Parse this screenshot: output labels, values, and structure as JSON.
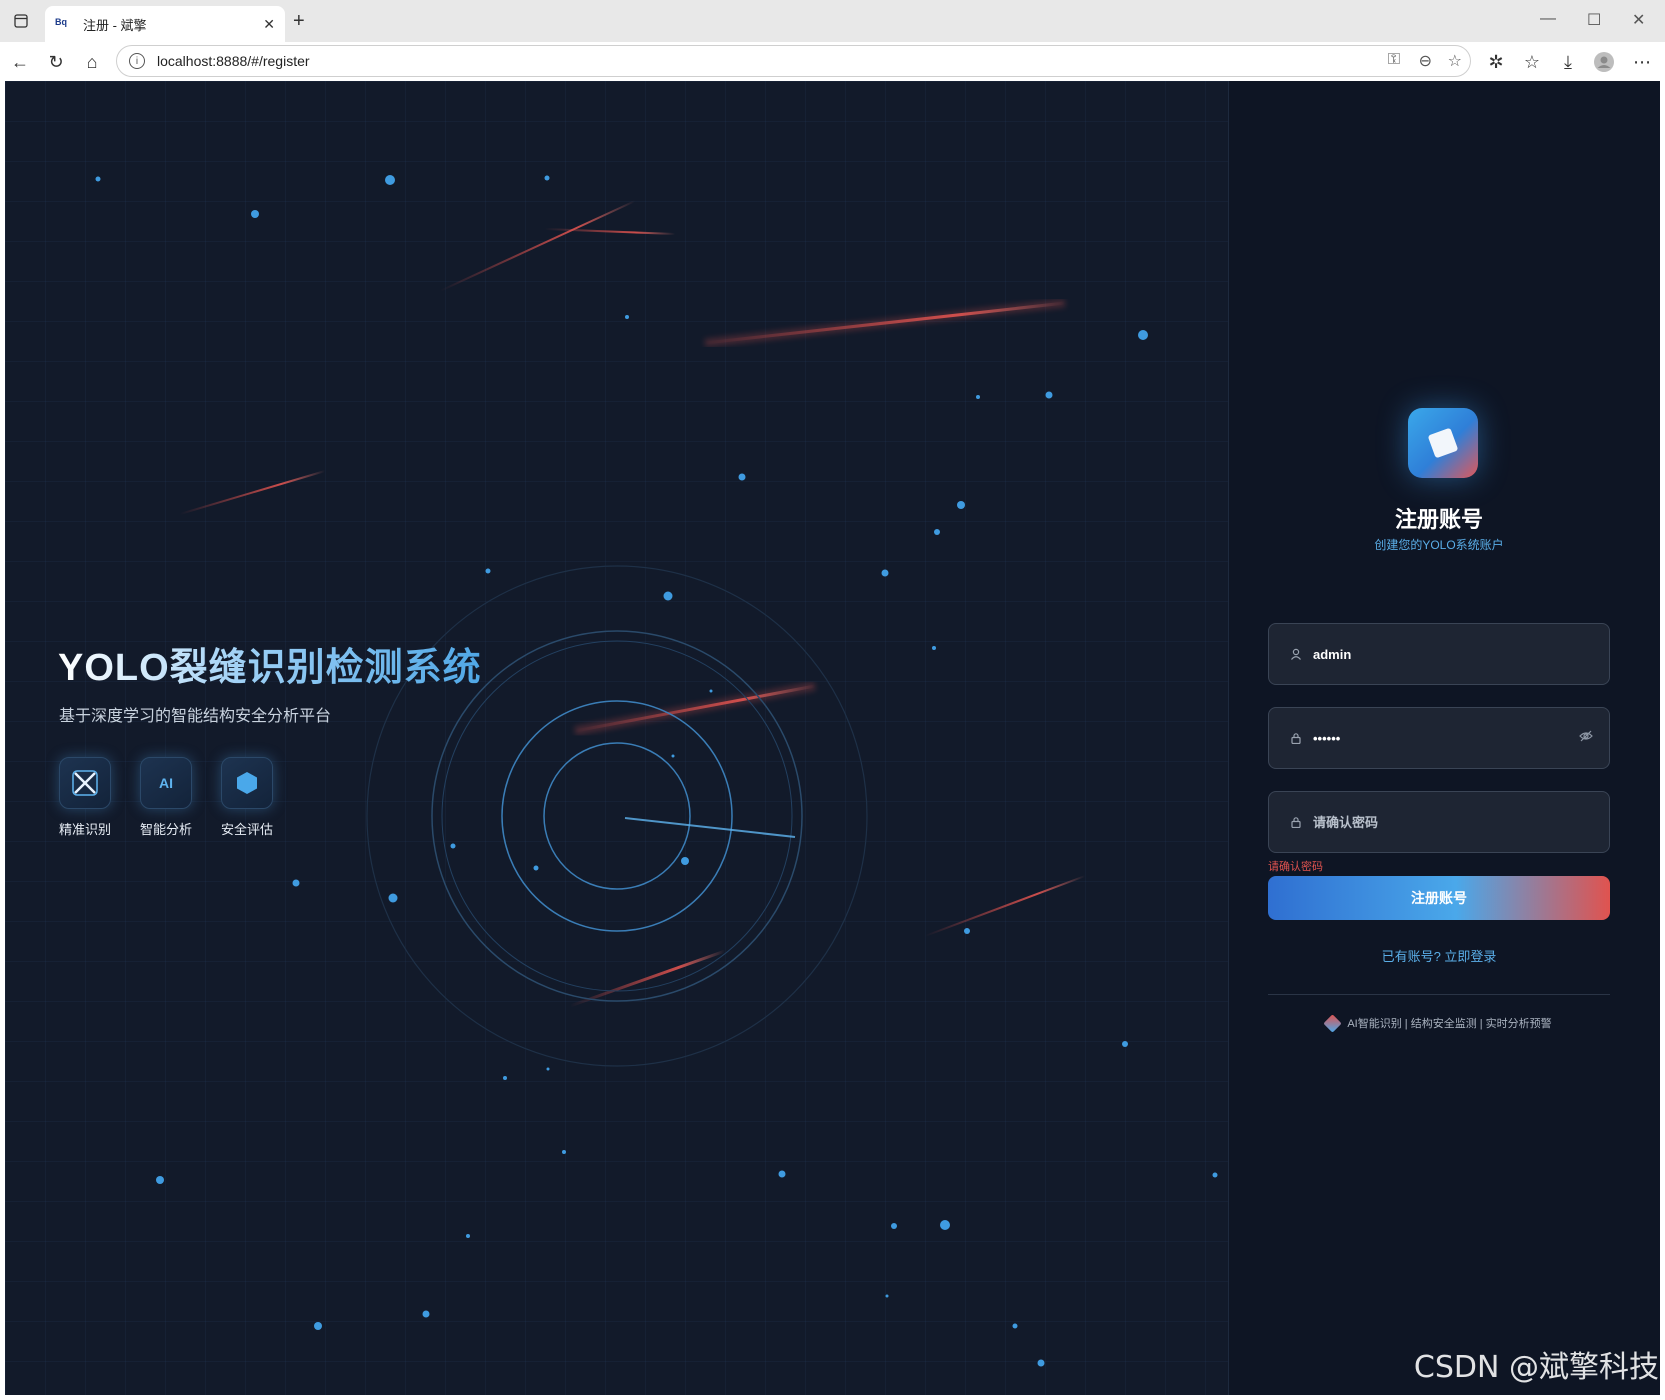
{
  "browser": {
    "tab_title": "注册 - 斌擎",
    "tab_favicon": "Bq",
    "url": "localhost:8888/#/register"
  },
  "hero": {
    "title": "YOLO裂缝识别检测系统",
    "subtitle": "基于深度学习的智能结构安全分析平台",
    "features": [
      {
        "label": "精准识别",
        "icon": "x-target-icon"
      },
      {
        "label": "智能分析",
        "icon": "ai-icon",
        "text": "AI"
      },
      {
        "label": "安全评估",
        "icon": "hexagon-icon"
      }
    ]
  },
  "register": {
    "title": "注册账号",
    "subtitle": "创建您的YOLO系统账户",
    "username_value": "admin",
    "password_value": "••••••",
    "confirm_placeholder": "请确认密码",
    "error_text": "请确认密码",
    "submit_label": "注册账号",
    "login_link": "已有账号? 立即登录",
    "footer": "AI智能识别 | 结构安全监测 | 实时分析预警"
  },
  "watermark": "CSDN @斌擎科技",
  "colors": {
    "background": "#121a2a",
    "accent_blue": "#4aa8ea",
    "accent_red": "#e0534f"
  }
}
